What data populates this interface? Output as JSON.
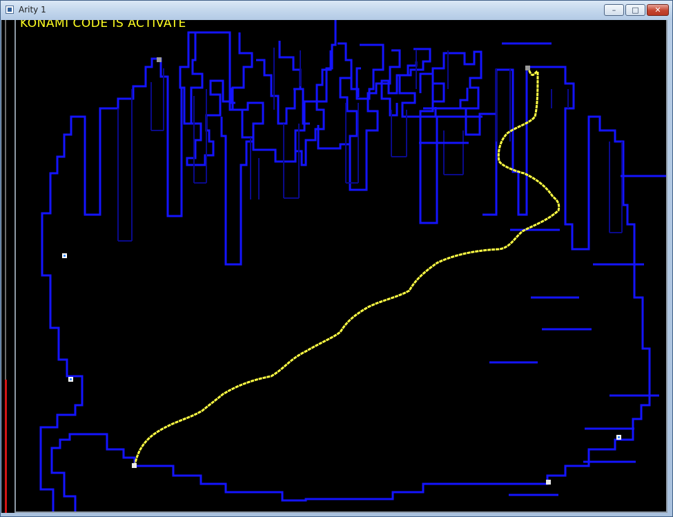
{
  "window": {
    "title": "Arity 1",
    "minimize_glyph": "–",
    "maximize_glyph": "□",
    "close_glyph": "✕"
  },
  "game": {
    "banner": "KONAMI CODE IS ACTIVATE",
    "health_fraction": 0.27,
    "colors": {
      "background": "#000000",
      "wall": "#1414ff",
      "wall_dim": "#0a0a8c",
      "trail": "#ffff44",
      "banner": "#ffff22",
      "health": "#d31515"
    },
    "markers": [
      {
        "name": "blue-marker",
        "color": "#3d8bff"
      },
      {
        "name": "blue-marker",
        "color": "#3d8bff"
      },
      {
        "name": "blue-marker",
        "color": "#3d8bff"
      },
      {
        "name": "gray-marker",
        "color": "#9a9a9a"
      },
      {
        "name": "gray-marker",
        "color": "#9a9a9a"
      },
      {
        "name": "white-marker",
        "color": "#e8e8e8"
      },
      {
        "name": "white-marker",
        "color": "#e8e8e8"
      }
    ]
  }
}
